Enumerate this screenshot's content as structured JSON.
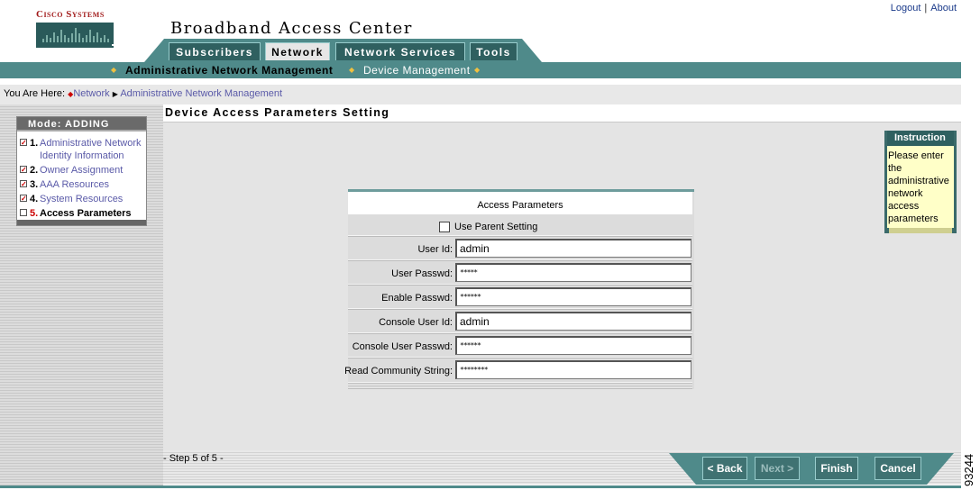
{
  "brand": {
    "company": "Cisco Systems",
    "app_title": "Broadband Access Center"
  },
  "top_links": {
    "logout": "Logout",
    "about": "About"
  },
  "tabs": [
    {
      "label": "Subscribers",
      "active": false
    },
    {
      "label": "Network",
      "active": true
    },
    {
      "label": "Network Services",
      "active": false
    },
    {
      "label": "Tools",
      "active": false
    }
  ],
  "subnav": [
    {
      "label": "Administrative Network Management",
      "active": true
    },
    {
      "label": "Device Management",
      "active": false
    }
  ],
  "breadcrumb": {
    "prefix": "You Are Here:",
    "items": [
      "Network",
      "Administrative Network Management"
    ]
  },
  "wizard": {
    "title": "Mode: ADDING",
    "steps": [
      {
        "num": "1.",
        "label": "Administrative Network Identity Information",
        "done": true
      },
      {
        "num": "2.",
        "label": "Owner Assignment",
        "done": true
      },
      {
        "num": "3.",
        "label": "AAA Resources",
        "done": true
      },
      {
        "num": "4.",
        "label": "System Resources",
        "done": true
      },
      {
        "num": "5.",
        "label": "Access Parameters",
        "done": false,
        "current": true
      }
    ]
  },
  "page": {
    "title": "Device Access Parameters Setting"
  },
  "form": {
    "title": "Access Parameters",
    "use_parent": {
      "label": "Use Parent Setting",
      "checked": false
    },
    "fields": [
      {
        "label": "User Id:",
        "value": "admin",
        "type": "text"
      },
      {
        "label": "User Passwd:",
        "value": "*****",
        "type": "password"
      },
      {
        "label": "Enable Passwd:",
        "value": "******",
        "type": "password"
      },
      {
        "label": "Console User Id:",
        "value": "admin",
        "type": "text"
      },
      {
        "label": "Console User Passwd:",
        "value": "******",
        "type": "password"
      },
      {
        "label": "Read Community String:",
        "value": "********",
        "type": "password"
      }
    ]
  },
  "instruction": {
    "title": "Instruction",
    "text": "Please enter the administrative network access parameters"
  },
  "footer": {
    "step_label": "- Step 5 of 5 -",
    "buttons": [
      {
        "label": "< Back",
        "enabled": true
      },
      {
        "label": "Next >",
        "enabled": false
      },
      {
        "label": "Finish",
        "enabled": true
      },
      {
        "label": "Cancel",
        "enabled": true
      }
    ]
  },
  "figure_id": "93244",
  "colors": {
    "teal": "#4f8a8a",
    "dark_teal": "#2f6060",
    "link": "#5a5aa8",
    "brand_red": "#a01818",
    "instruction_bg": "#ffffc8"
  }
}
